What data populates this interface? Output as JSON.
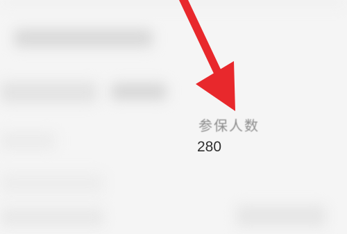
{
  "field": {
    "label": "参保人数",
    "value": "280"
  },
  "annotation": {
    "icon": "red-arrow-icon",
    "color": "#e8282c"
  }
}
